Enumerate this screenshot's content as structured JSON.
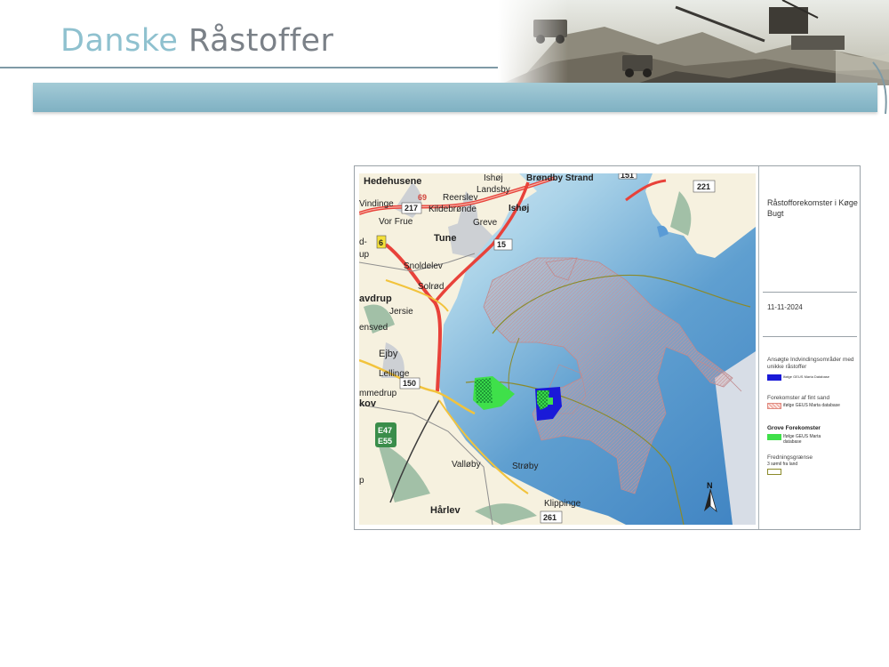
{
  "brand": {
    "word1": "Danske",
    "word2": "Råstoffer"
  },
  "map": {
    "places": {
      "hedehusene": "Hedehusene",
      "ishoj_top": "Ishøj",
      "brondby": "Brøndby Strand",
      "reerslev": "Reerslev",
      "landsby": "Landsby",
      "vindinge": "Vindinge",
      "kildebronde": "Kildebrønde",
      "ishoj": "Ishøj",
      "greve": "Greve",
      "vorfrue": "Vor Frue",
      "tune": "Tune",
      "d": "d-",
      "up": "up",
      "snoldelev": "Snoldelev",
      "solrod": "Solrød",
      "avdrup": "avdrup",
      "jersie": "Jersie",
      "ensved": "ensved",
      "ejby": "Ejby",
      "lellinge": "Lellinge",
      "mmedrup": "mmedrup",
      "kov": "kov",
      "valloby": "Valløby",
      "stroby": "Strøby",
      "p": "p",
      "harlev": "Hårlev",
      "klippinge": "Klippinge"
    },
    "roads": {
      "r69": "69",
      "r217": "217",
      "r6": "6",
      "r151": "151",
      "r151b": "15",
      "r221": "221",
      "r150": "150",
      "e47": "E47",
      "e55": "E55",
      "r261": "261"
    },
    "north": "N"
  },
  "legend": {
    "title": "Råstofforekomster i Køge Bugt",
    "date": "11-11-2024",
    "section1_title": "Ansøgte Indvindingsområder med unikke råstoffer",
    "section1_item": "Ifølge GEUS Marta Database",
    "section2_title": "Forekomster af fint sand",
    "section2_item": "ifølge GEUS Marta database",
    "section3_title": "Grove Forekomster",
    "section3_item": "Ifølge GEUS Marta database",
    "section4_title": "Fredningsgrænse",
    "section4_item": "3 sømil fra land",
    "colors": {
      "unique": "#1a1ad8",
      "fine_sand": "#f2b6ad",
      "coarse": "#3fe04a",
      "boundary": "#8b8a2a"
    }
  }
}
